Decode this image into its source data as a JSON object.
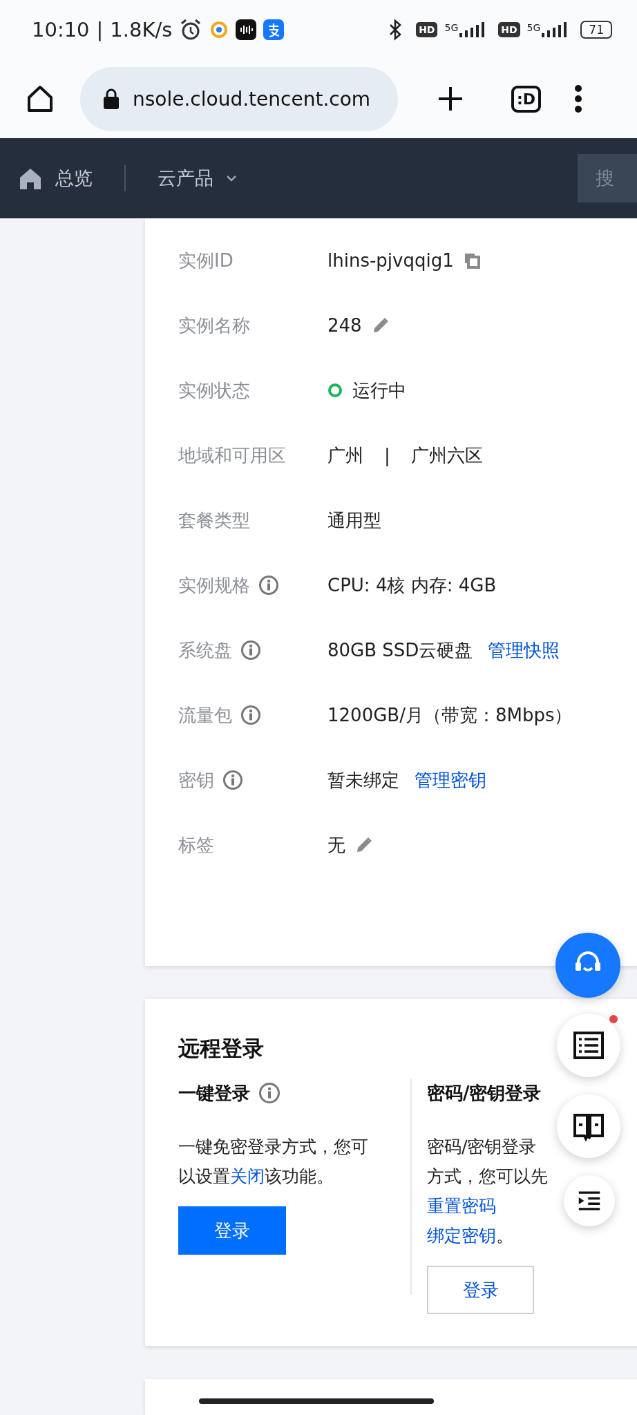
{
  "status_bar": {
    "time": "10:10",
    "separator": "|",
    "speed": "1.8K/s",
    "network": [
      {
        "hd": "HD",
        "type": "5G"
      },
      {
        "hd": "HD",
        "type": "5G"
      }
    ],
    "battery": "71"
  },
  "browser": {
    "url": "nsole.cloud.tencent.com",
    "tabs_button": ":D"
  },
  "nav": {
    "items": [
      {
        "label": "总览",
        "kind": "home"
      },
      {
        "label": "云产品",
        "kind": "dropdown"
      }
    ],
    "search": {
      "placeholder": "搜"
    }
  },
  "instance_info": {
    "rows": [
      {
        "label": "实例ID",
        "value": "lhins-pjvqqig1",
        "info": false,
        "copyable": true,
        "editable": false
      },
      {
        "label": "实例名称",
        "value": "248",
        "info": false,
        "copyable": false,
        "editable": true
      },
      {
        "label": "实例状态",
        "value": "运行中",
        "info": false,
        "copyable": false,
        "editable": false,
        "kind": "status",
        "color": "#1db45a"
      },
      {
        "label": "地域和可用区",
        "value": "广州",
        "separator": "|",
        "value_2": "广州六区",
        "info": false,
        "copyable": false,
        "editable": false
      },
      {
        "label": "套餐类型",
        "value": "通用型",
        "info": false,
        "copyable": false,
        "editable": false
      },
      {
        "label": "实例规格",
        "value": "CPU: 4核 内存: 4GB",
        "info": true,
        "copyable": false,
        "editable": false
      },
      {
        "label": "系统盘",
        "value": "80GB SSD云硬盘",
        "link": "管理快照",
        "info": true,
        "copyable": false,
        "editable": false
      },
      {
        "label": "流量包",
        "value": "1200GB/月（带宽：8Mbps）",
        "info": true,
        "copyable": false,
        "editable": false
      },
      {
        "label": "密钥",
        "value": "暂未绑定",
        "link": "管理密钥",
        "info": true,
        "copyable": false,
        "editable": false
      },
      {
        "label": "标签",
        "value": "无",
        "info": false,
        "copyable": false,
        "editable": true
      }
    ]
  },
  "remote_login": {
    "title": "远程登录",
    "columns": [
      {
        "title": "一键登录",
        "info": true,
        "description": [
          {
            "kind": "text",
            "text": "一键免密登录方式，您可以设置"
          },
          {
            "kind": "link",
            "text": "关闭"
          },
          {
            "kind": "text",
            "text": "该功能。"
          }
        ],
        "button": {
          "label": "登录",
          "kind": "primary"
        }
      },
      {
        "title": "密码/密钥登录",
        "info": false,
        "description": [
          {
            "kind": "text",
            "text": "密码/密钥登录方式，您可以先 "
          },
          {
            "kind": "link",
            "text": "重置密码"
          },
          {
            "kind": "break"
          },
          {
            "kind": "link",
            "text": "绑定密钥"
          },
          {
            "kind": "text",
            "text": "。"
          }
        ],
        "button": {
          "label": "登录",
          "kind": "secondary"
        }
      }
    ]
  },
  "floating_buttons": [
    {
      "kind": "support",
      "badge": false
    },
    {
      "kind": "list",
      "badge": true
    },
    {
      "kind": "book",
      "badge": false
    },
    {
      "kind": "indent",
      "badge": false
    }
  ]
}
